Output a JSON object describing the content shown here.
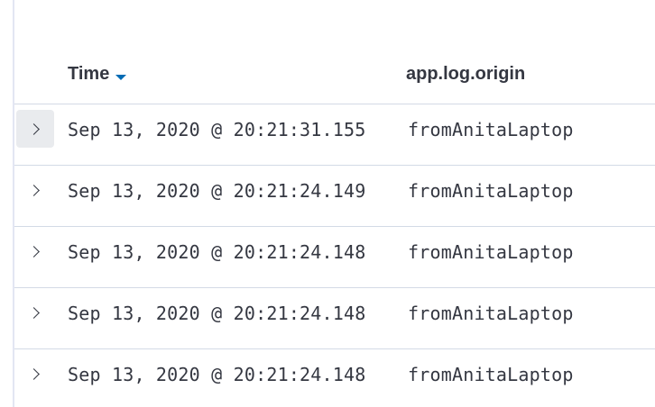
{
  "table": {
    "columns": {
      "time": "Time",
      "origin": "app.log.origin"
    },
    "sort": {
      "column": "time",
      "direction": "descending",
      "icon": "sort-descending-icon",
      "color": "#006bb4"
    },
    "rows": [
      {
        "time": "Sep 13, 2020 @ 20:21:31.155",
        "origin": "fromAnitaLaptop",
        "expand_icon": "chevron-right-icon",
        "hovered": true
      },
      {
        "time": "Sep 13, 2020 @ 20:21:24.149",
        "origin": "fromAnitaLaptop",
        "expand_icon": "chevron-right-icon",
        "hovered": false
      },
      {
        "time": "Sep 13, 2020 @ 20:21:24.148",
        "origin": "fromAnitaLaptop",
        "expand_icon": "chevron-right-icon",
        "hovered": false
      },
      {
        "time": "Sep 13, 2020 @ 20:21:24.148",
        "origin": "fromAnitaLaptop",
        "expand_icon": "chevron-right-icon",
        "hovered": false
      },
      {
        "time": "Sep 13, 2020 @ 20:21:24.148",
        "origin": "fromAnitaLaptop",
        "expand_icon": "chevron-right-icon",
        "hovered": false
      }
    ]
  }
}
